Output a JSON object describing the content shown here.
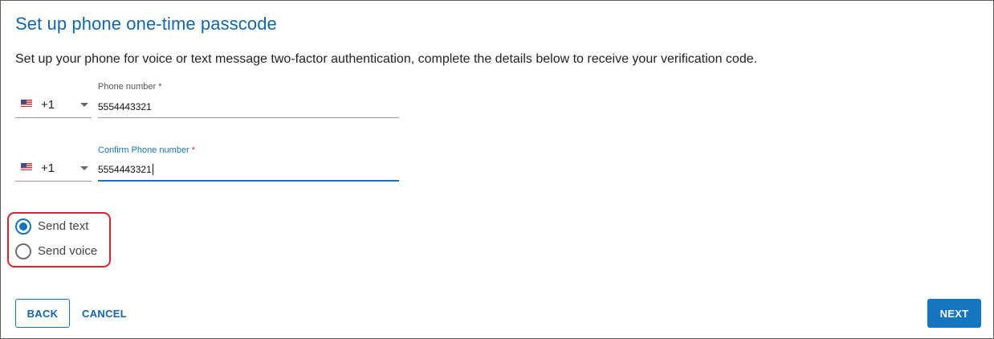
{
  "page": {
    "title": "Set up phone one-time passcode",
    "description": "Set up your phone for voice or text message two-factor authentication, complete the details below to receive your verification code."
  },
  "phone": {
    "country_flag": "us-flag-icon",
    "country_code": "+1",
    "label": "Phone number",
    "required_marker": "*",
    "value": "5554443321"
  },
  "confirm_phone": {
    "country_flag": "us-flag-icon",
    "country_code": "+1",
    "label": "Confirm Phone number",
    "required_marker": "*",
    "value": "5554443321"
  },
  "delivery": {
    "options": [
      {
        "label": "Send text",
        "selected": true
      },
      {
        "label": "Send voice",
        "selected": false
      }
    ]
  },
  "actions": {
    "back": "BACK",
    "cancel": "CANCEL",
    "next": "NEXT"
  },
  "colors": {
    "accent": "#1872b8",
    "title": "#1466a6",
    "highlight": "#d4262f",
    "required": "#d32f2f"
  }
}
